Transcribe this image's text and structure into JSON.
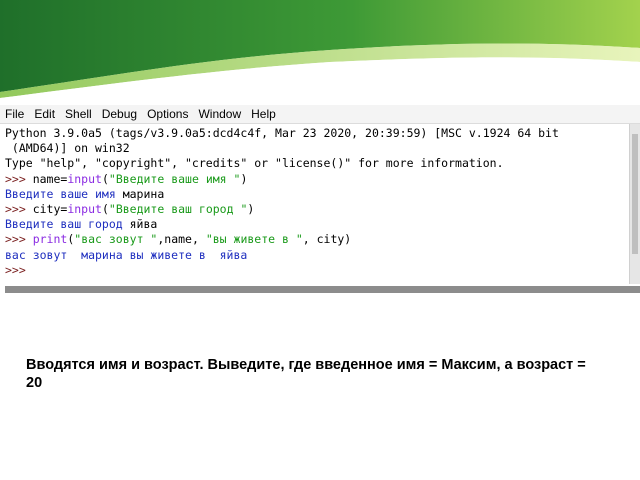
{
  "menu": [
    "File",
    "Edit",
    "Shell",
    "Debug",
    "Options",
    "Window",
    "Help"
  ],
  "shell_lines": [
    [
      {
        "t": "Python 3.9.0a5 (tags/v3.9.0a5:dcd4c4f, Mar 23 2020, 20:39:59) [MSC v.1924 64 bit",
        "c": "plain"
      }
    ],
    [
      {
        "t": " (AMD64)] on win32",
        "c": "plain"
      }
    ],
    [
      {
        "t": "Type \"help\", \"copyright\", \"credits\" or \"license()\" for more information.",
        "c": "plain"
      }
    ],
    [
      {
        "t": ">>> ",
        "c": "prompt"
      },
      {
        "t": "name=",
        "c": "plain"
      },
      {
        "t": "input",
        "c": "builtin"
      },
      {
        "t": "(",
        "c": "plain"
      },
      {
        "t": "\"Введите ваше имя \"",
        "c": "string"
      },
      {
        "t": ")",
        "c": "plain"
      }
    ],
    [
      {
        "t": "Введите ваше имя ",
        "c": "out"
      },
      {
        "t": "марина",
        "c": "plain"
      }
    ],
    [
      {
        "t": ">>> ",
        "c": "prompt"
      },
      {
        "t": "city=",
        "c": "plain"
      },
      {
        "t": "input",
        "c": "builtin"
      },
      {
        "t": "(",
        "c": "plain"
      },
      {
        "t": "\"Введите ваш город \"",
        "c": "string"
      },
      {
        "t": ")",
        "c": "plain"
      }
    ],
    [
      {
        "t": "Введите ваш город ",
        "c": "out"
      },
      {
        "t": "яйва",
        "c": "plain"
      }
    ],
    [
      {
        "t": ">>> ",
        "c": "prompt"
      },
      {
        "t": "print",
        "c": "builtin"
      },
      {
        "t": "(",
        "c": "plain"
      },
      {
        "t": "\"вас зовут \"",
        "c": "string"
      },
      {
        "t": ",name, ",
        "c": "plain"
      },
      {
        "t": "\"вы живете в \"",
        "c": "string"
      },
      {
        "t": ", city)",
        "c": "plain"
      }
    ],
    [
      {
        "t": "вас зовут  марина вы живете в  яйва",
        "c": "out"
      }
    ],
    [
      {
        "t": ">>> ",
        "c": "prompt"
      }
    ]
  ],
  "task_text": "Вводятся имя и возраст. Выведите, где введенное имя = Максим, а возраст = 20",
  "colors": {
    "prompt": "#7a1f1f",
    "builtin": "#8a2be2",
    "string": "#1a9a1a",
    "output": "#1f2fbf",
    "banner_green": "#2f8f2f",
    "banner_light": "#9fd24a"
  }
}
